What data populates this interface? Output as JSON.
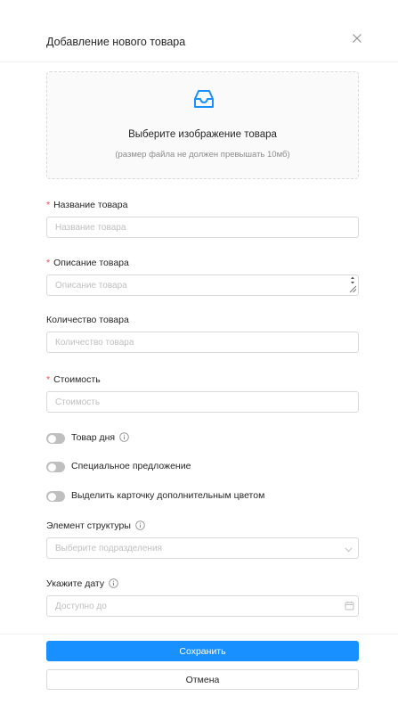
{
  "modal": {
    "title": "Добавление нового товара"
  },
  "upload": {
    "text": "Выберите изображение товара",
    "hint": "(размер файла не должен превышать 10мб)"
  },
  "fields": {
    "name": {
      "label": "Название товара",
      "placeholder": "Название товара",
      "value": ""
    },
    "description": {
      "label": "Описание товара",
      "placeholder": "Описание товара",
      "value": ""
    },
    "quantity": {
      "label": "Количество товара",
      "placeholder": "Количество товара",
      "value": ""
    },
    "price": {
      "label": "Стоимость",
      "placeholder": "Стоимость",
      "value": ""
    }
  },
  "switches": [
    {
      "label": "Товар дня",
      "on": false,
      "has_info": true
    },
    {
      "label": "Специальное предложение",
      "on": false,
      "has_info": false
    },
    {
      "label": "Выделить карточку дополнительным цветом",
      "on": false,
      "has_info": false
    }
  ],
  "structure": {
    "label": "Элемент структуры",
    "placeholder": "Выберите подразделения"
  },
  "date": {
    "label": "Укажите дату",
    "placeholder": "Доступно до"
  },
  "buttons": {
    "save": "Сохранить",
    "cancel": "Отмена"
  },
  "icons": {
    "close": "close-icon",
    "upload": "inbox-icon",
    "info": "info-circle-icon",
    "select": "chevron-down-icon",
    "date": "calendar-icon"
  },
  "colors": {
    "primary": "#1890ff",
    "required": "#ff4d4f",
    "switch_off": "#bfbfbf",
    "border": "#d9d9d9"
  }
}
